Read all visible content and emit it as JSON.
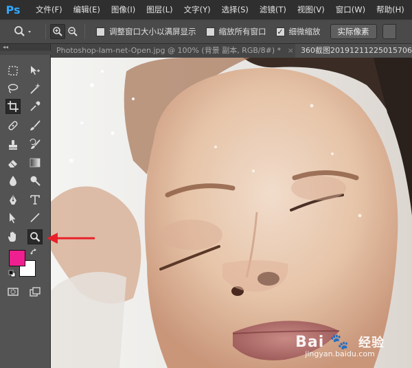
{
  "app": {
    "logo": "Ps"
  },
  "menu": [
    "文件(F)",
    "编辑(E)",
    "图像(I)",
    "图层(L)",
    "文字(Y)",
    "选择(S)",
    "滤镜(T)",
    "视图(V)",
    "窗口(W)",
    "帮助(H)"
  ],
  "options": {
    "resize_window": "调整窗口大小以满屏显示",
    "zoom_all_windows": "缩放所有窗口",
    "scrubby_zoom": "细微缩放",
    "actual_pixels": "实际像素",
    "resize_checked": false,
    "zoom_all_checked": false,
    "scrubby_checked": true
  },
  "tabs": [
    {
      "label": "Photoshop-lam-net-Open.jpg @ 100% (背景 副本, RGB/8#) *",
      "close": "×"
    },
    {
      "label": "360截图20191211225015706"
    }
  ],
  "toolpanel": {
    "grip": "◂◂"
  },
  "colors": {
    "foreground": "#ee1f8e",
    "background": "#ffffff",
    "annotation_arrow": "#e8202a"
  },
  "watermark": {
    "brand": "Bai",
    "brand2": "经验",
    "url": "jingyan.baidu.com"
  }
}
